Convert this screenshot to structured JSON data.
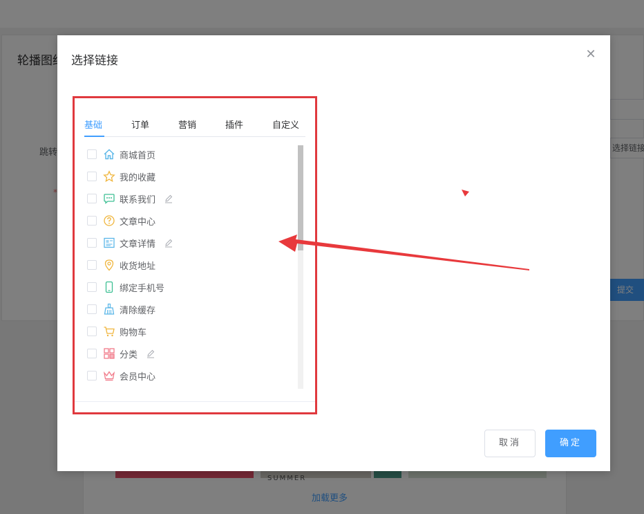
{
  "background": {
    "card_title": "轮播图红",
    "jump_label": "跳转",
    "required_mark": "*",
    "select_link_button": "选择链接",
    "submit_button": "提交",
    "thumb_text": "SUMMER",
    "load_more": "加载更多"
  },
  "dialog": {
    "title": "选择链接",
    "tabs": [
      {
        "label": "基础",
        "active": true
      },
      {
        "label": "订单",
        "active": false
      },
      {
        "label": "营销",
        "active": false
      },
      {
        "label": "插件",
        "active": false
      },
      {
        "label": "自定义",
        "active": false
      }
    ],
    "items": [
      {
        "label": "商城首页",
        "icon": "home-icon",
        "editable": false
      },
      {
        "label": "我的收藏",
        "icon": "star-icon",
        "editable": false
      },
      {
        "label": "联系我们",
        "icon": "chat-icon",
        "editable": true
      },
      {
        "label": "文章中心",
        "icon": "question-icon",
        "editable": false
      },
      {
        "label": "文章详情",
        "icon": "article-icon",
        "editable": true
      },
      {
        "label": "收货地址",
        "icon": "location-pin-icon",
        "editable": false
      },
      {
        "label": "绑定手机号",
        "icon": "phone-icon",
        "editable": false
      },
      {
        "label": "清除缓存",
        "icon": "broom-icon",
        "editable": false
      },
      {
        "label": "购物车",
        "icon": "cart-icon",
        "editable": false
      },
      {
        "label": "分类",
        "icon": "category-grid-icon",
        "editable": true
      },
      {
        "label": "会员中心",
        "icon": "crown-icon",
        "editable": false
      }
    ],
    "cancel_label": "取消",
    "ok_label": "确定"
  },
  "colors": {
    "primary": "#409eff",
    "highlight_border": "#e0393e",
    "annotation_arrow": "#e8393c"
  }
}
